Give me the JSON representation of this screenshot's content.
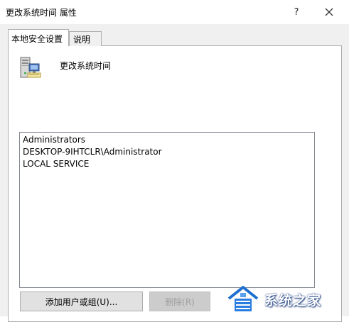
{
  "window": {
    "title": "更改系统时间 属性"
  },
  "title_buttons": {
    "help": "?",
    "close_icon": "close-icon"
  },
  "tabs": [
    {
      "label": "本地安全设置",
      "selected": true
    },
    {
      "label": "说明",
      "selected": false
    }
  ],
  "policy": {
    "icon": "server-computer-icon",
    "name": "更改系统时间"
  },
  "members": [
    "Administrators",
    "DESKTOP-9IHTCLR\\Administrator",
    "LOCAL SERVICE"
  ],
  "buttons": {
    "add": {
      "label": "添加用户或组(U)...",
      "enabled": true
    },
    "remove": {
      "label": "删除(R)",
      "enabled": false
    }
  },
  "watermark": {
    "text": "系统之家",
    "icon": "house-logo-icon"
  }
}
